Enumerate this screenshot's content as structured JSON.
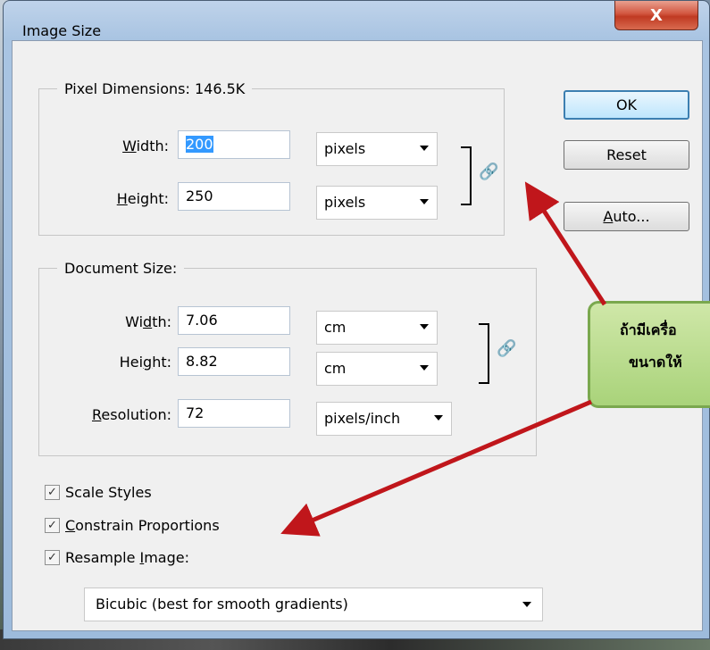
{
  "window": {
    "title": "Image Size",
    "close_glyph": "X"
  },
  "pixel_dimensions": {
    "legend": "Pixel Dimensions:  146.5K",
    "width_label_pre": "",
    "width_label_u": "W",
    "width_label_post": "idth:",
    "width_value": "200",
    "width_unit": "pixels",
    "height_label_pre": "",
    "height_label_u": "H",
    "height_label_post": "eight:",
    "height_value": "250",
    "height_unit": "pixels"
  },
  "document_size": {
    "legend": "Document Size:",
    "width_label_pre": "Wi",
    "width_label_u": "d",
    "width_label_post": "th:",
    "width_value": "7.06",
    "width_unit": "cm",
    "height_label_pre": "Hei",
    "height_label_u": "g",
    "height_label_post": "ht:",
    "height_value": "8.82",
    "height_unit": "cm",
    "resolution_label_pre": "",
    "resolution_label_u": "R",
    "resolution_label_post": "esolution:",
    "resolution_value": "72",
    "resolution_unit": "pixels/inch"
  },
  "buttons": {
    "ok": "OK",
    "reset": "Reset",
    "auto_u": "A",
    "auto_post": "uto..."
  },
  "options": {
    "scale_styles": "Scale Styles",
    "constrain_u": "C",
    "constrain_post": "onstrain Proportions",
    "resample_pre": "Resample ",
    "resample_u": "I",
    "resample_post": "mage:",
    "resample_method": "Bicubic (best for smooth gradients)"
  },
  "callout": {
    "line1": "ถ้ามีเครื่อ",
    "line2": "ขนาดให้"
  },
  "colors": {
    "arrow": "#c0161b",
    "callout_fill": "#b8dc8c",
    "callout_border": "#7aa84e"
  },
  "icons": [
    "close-icon",
    "chain-link-icon",
    "dropdown-arrow-icon",
    "checkmark-icon"
  ]
}
